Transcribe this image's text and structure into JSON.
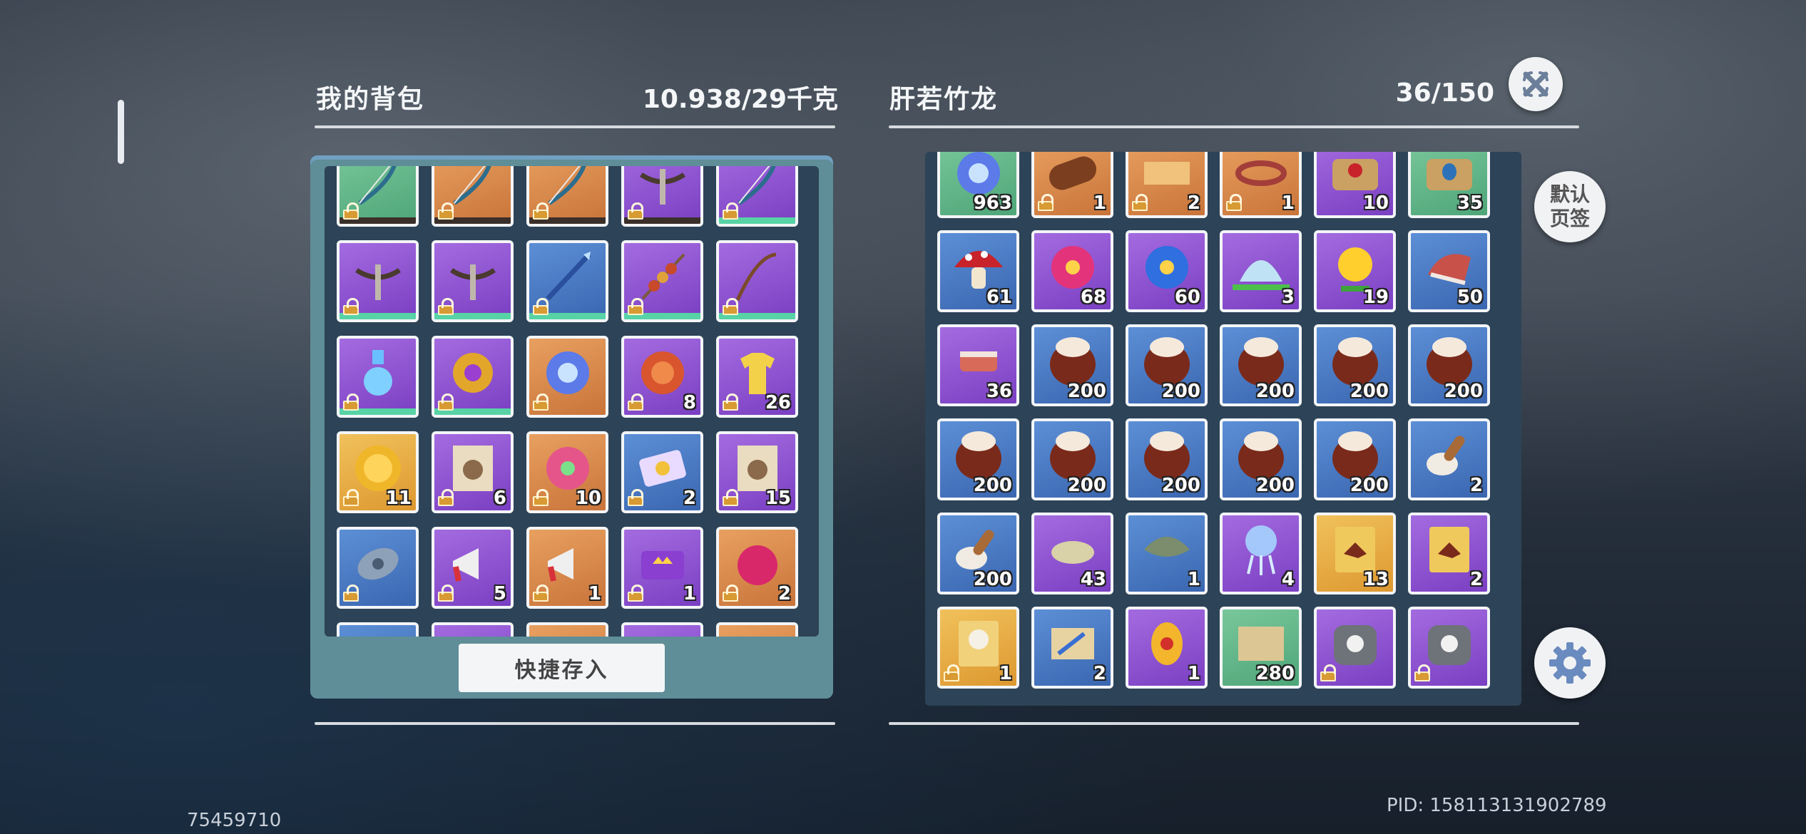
{
  "backpack": {
    "title": "我的背包",
    "weight": "10.938/29千克",
    "quick_store_label": "快捷存入",
    "items": [
      {
        "name": "bow",
        "rarity": "green",
        "qty": "",
        "bar": "dark"
      },
      {
        "name": "bow",
        "rarity": "orange",
        "qty": "",
        "bar": "dark"
      },
      {
        "name": "bow",
        "rarity": "orange",
        "qty": "",
        "bar": "dark"
      },
      {
        "name": "crossbow",
        "rarity": "purple",
        "qty": "",
        "bar": "dark"
      },
      {
        "name": "bow",
        "rarity": "purple",
        "qty": "",
        "bar": "green"
      },
      {
        "name": "crossbow",
        "rarity": "purple",
        "qty": "",
        "bar": "green"
      },
      {
        "name": "crossbow",
        "rarity": "purple",
        "qty": "",
        "bar": "green"
      },
      {
        "name": "spear",
        "rarity": "blue",
        "qty": "",
        "bar": "green"
      },
      {
        "name": "skewer",
        "rarity": "purple",
        "qty": "",
        "bar": "green"
      },
      {
        "name": "fishing-rod",
        "rarity": "purple",
        "qty": "",
        "bar": "green"
      },
      {
        "name": "potion",
        "rarity": "purple",
        "qty": "",
        "bar": "green"
      },
      {
        "name": "amulet",
        "rarity": "purple",
        "qty": "",
        "bar": "green"
      },
      {
        "name": "orb",
        "rarity": "orange",
        "qty": "",
        "bar": ""
      },
      {
        "name": "coin",
        "rarity": "purple",
        "qty": "8",
        "bar": ""
      },
      {
        "name": "shirt",
        "rarity": "purple",
        "qty": "26",
        "bar": ""
      },
      {
        "name": "gold-coin",
        "rarity": "gold",
        "qty": "11",
        "bar": ""
      },
      {
        "name": "wanted-poster",
        "rarity": "purple",
        "qty": "6",
        "bar": ""
      },
      {
        "name": "flower",
        "rarity": "orange",
        "qty": "10",
        "bar": ""
      },
      {
        "name": "ticket",
        "rarity": "blue",
        "qty": "2",
        "bar": ""
      },
      {
        "name": "wanted-poster",
        "rarity": "purple",
        "qty": "15",
        "bar": ""
      },
      {
        "name": "stone",
        "rarity": "blue",
        "qty": "",
        "bar": ""
      },
      {
        "name": "megaphone",
        "rarity": "purple",
        "qty": "5",
        "bar": ""
      },
      {
        "name": "megaphone",
        "rarity": "orange",
        "qty": "1",
        "bar": ""
      },
      {
        "name": "crown-ticket",
        "rarity": "purple",
        "qty": "1",
        "bar": ""
      },
      {
        "name": "berry",
        "rarity": "orange",
        "qty": "2",
        "bar": ""
      },
      {
        "name": "partial",
        "rarity": "blue",
        "qty": "",
        "bar": ""
      },
      {
        "name": "partial",
        "rarity": "purple",
        "qty": "",
        "bar": ""
      },
      {
        "name": "partial",
        "rarity": "orange",
        "qty": "",
        "bar": ""
      },
      {
        "name": "partial",
        "rarity": "purple",
        "qty": "",
        "bar": ""
      },
      {
        "name": "partial",
        "rarity": "orange",
        "qty": "",
        "bar": ""
      }
    ]
  },
  "storage": {
    "title": "肝若竹龙",
    "capacity": "36/150",
    "items": [
      {
        "name": "orb",
        "rarity": "green",
        "qty": "963"
      },
      {
        "name": "log",
        "rarity": "orange",
        "qty": "1"
      },
      {
        "name": "fabric",
        "rarity": "orange",
        "qty": "2"
      },
      {
        "name": "bracelet",
        "rarity": "orange",
        "qty": "1"
      },
      {
        "name": "mushroom-bag",
        "rarity": "purple",
        "qty": "10"
      },
      {
        "name": "acorn-bag",
        "rarity": "green",
        "qty": "35"
      },
      {
        "name": "mushroom",
        "rarity": "blue",
        "qty": "61"
      },
      {
        "name": "pink-flower",
        "rarity": "purple",
        "qty": "68"
      },
      {
        "name": "blue-lotus",
        "rarity": "purple",
        "qty": "60"
      },
      {
        "name": "lotus",
        "rarity": "purple",
        "qty": "3"
      },
      {
        "name": "yellow-flower",
        "rarity": "purple",
        "qty": "19"
      },
      {
        "name": "meat",
        "rarity": "blue",
        "qty": "50"
      },
      {
        "name": "meat-skewer",
        "rarity": "purple",
        "qty": "36"
      },
      {
        "name": "egg",
        "rarity": "blue",
        "qty": "200"
      },
      {
        "name": "egg",
        "rarity": "blue",
        "qty": "200"
      },
      {
        "name": "egg",
        "rarity": "blue",
        "qty": "200"
      },
      {
        "name": "egg",
        "rarity": "blue",
        "qty": "200"
      },
      {
        "name": "egg",
        "rarity": "blue",
        "qty": "200"
      },
      {
        "name": "egg",
        "rarity": "blue",
        "qty": "200"
      },
      {
        "name": "egg",
        "rarity": "blue",
        "qty": "200"
      },
      {
        "name": "egg",
        "rarity": "blue",
        "qty": "200"
      },
      {
        "name": "egg",
        "rarity": "blue",
        "qty": "200"
      },
      {
        "name": "egg",
        "rarity": "blue",
        "qty": "200"
      },
      {
        "name": "drumstick",
        "rarity": "blue",
        "qty": "2"
      },
      {
        "name": "drumstick",
        "rarity": "blue",
        "qty": "200"
      },
      {
        "name": "fish",
        "rarity": "purple",
        "qty": "43"
      },
      {
        "name": "stingray",
        "rarity": "blue",
        "qty": "1"
      },
      {
        "name": "jellyfish",
        "rarity": "purple",
        "qty": "4"
      },
      {
        "name": "dino-feed",
        "rarity": "gold",
        "qty": "13"
      },
      {
        "name": "dino-feed",
        "rarity": "purple",
        "qty": "2"
      },
      {
        "name": "feed-bag",
        "rarity": "gold",
        "qty": "1"
      },
      {
        "name": "scroll",
        "rarity": "blue",
        "qty": "2"
      },
      {
        "name": "gem-egg",
        "rarity": "purple",
        "qty": "1"
      },
      {
        "name": "map",
        "rarity": "green",
        "qty": "280"
      },
      {
        "name": "pet-carrier",
        "rarity": "purple",
        "qty": ""
      },
      {
        "name": "pet-carrier",
        "rarity": "purple",
        "qty": ""
      }
    ]
  },
  "buttons": {
    "close_icon": "close-icon",
    "default_tab_label": "默认\n页签",
    "settings_icon": "gear-icon"
  },
  "footer": {
    "uid": "75459710",
    "pid": "PID: 158113131902789"
  },
  "colors": {
    "purple": "#8a4fd0",
    "blue": "#4a78c4",
    "orange": "#d88a48",
    "green": "#5fb487",
    "gold": "#e7ac44"
  }
}
